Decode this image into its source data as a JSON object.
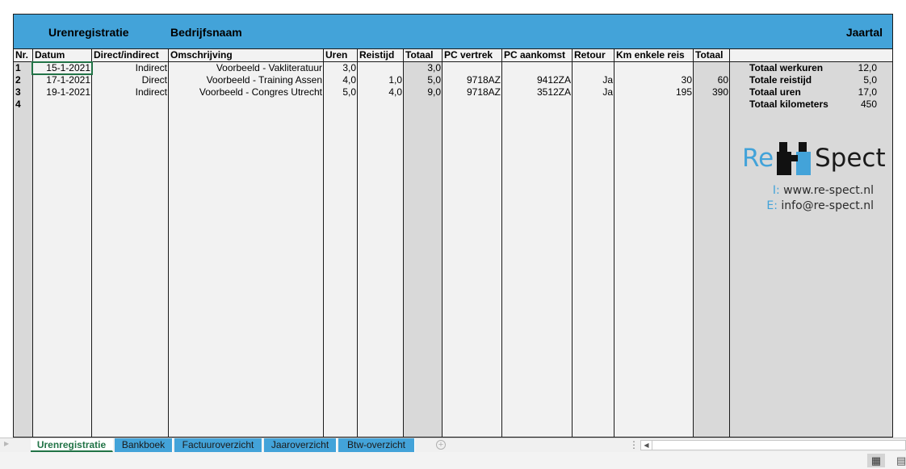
{
  "banner": {
    "title": "Urenregistratie",
    "company": "Bedrijfsnaam",
    "year": "Jaartal"
  },
  "columns": [
    "Nr.",
    "Datum",
    "Direct/indirect",
    "Omschrijving",
    "Uren",
    "Reistijd",
    "Totaal",
    "PC vertrek",
    "PC aankomst",
    "Retour",
    "Km enkele reis",
    "Totaal"
  ],
  "rows": [
    {
      "nr": "1",
      "datum": "15-1-2021",
      "type": "Indirect",
      "omschrijving": "Voorbeeld - Vakliteratuur",
      "uren": "3,0",
      "reistijd": "",
      "totaal": "3,0",
      "pc_vertrek": "",
      "pc_aankomst": "",
      "retour": "",
      "km": "",
      "km_totaal": ""
    },
    {
      "nr": "2",
      "datum": "17-1-2021",
      "type": "Direct",
      "omschrijving": "Voorbeeld - Training Assen",
      "uren": "4,0",
      "reistijd": "1,0",
      "totaal": "5,0",
      "pc_vertrek": "9718AZ",
      "pc_aankomst": "9412ZA",
      "retour": "Ja",
      "km": "30",
      "km_totaal": "60"
    },
    {
      "nr": "3",
      "datum": "19-1-2021",
      "type": "Indirect",
      "omschrijving": "Voorbeeld - Congres Utrecht",
      "uren": "5,0",
      "reistijd": "4,0",
      "totaal": "9,0",
      "pc_vertrek": "9718AZ",
      "pc_aankomst": "3512ZA",
      "retour": "Ja",
      "km": "195",
      "km_totaal": "390"
    },
    {
      "nr": "4",
      "datum": "",
      "type": "",
      "omschrijving": "",
      "uren": "",
      "reistijd": "",
      "totaal": "",
      "pc_vertrek": "",
      "pc_aankomst": "",
      "retour": "",
      "km": "",
      "km_totaal": ""
    }
  ],
  "summary": [
    {
      "label": "Totaal werkuren",
      "value": "12,0"
    },
    {
      "label": "Totale reistijd",
      "value": "5,0"
    },
    {
      "label": "Totaal uren",
      "value": "17,0"
    },
    {
      "label": "Totaal kilometers",
      "value": "450"
    }
  ],
  "logo": {
    "part1": "Re",
    "part2": "Spect",
    "internet_prefix": "I:",
    "internet": "www.re-spect.nl",
    "email_prefix": "E:",
    "email": "info@re-spect.nl"
  },
  "tabs": [
    "Urenregistratie",
    "Bankboek",
    "Factuuroverzicht",
    "Jaaroverzicht",
    "Btw-overzicht"
  ],
  "active_tab": "Urenregistratie",
  "colors": {
    "accent": "#43a3d9",
    "grey_column": "#d9d9d9",
    "sheet_bg": "#f2f2f2",
    "selection": "#217346"
  },
  "icons": {
    "logo_mark": "binoculars-icon",
    "add_sheet": "plus-circle-icon",
    "scroll_left": "triangle-left-icon",
    "normal_view": "grid-icon",
    "page_layout": "page-layout-icon"
  }
}
